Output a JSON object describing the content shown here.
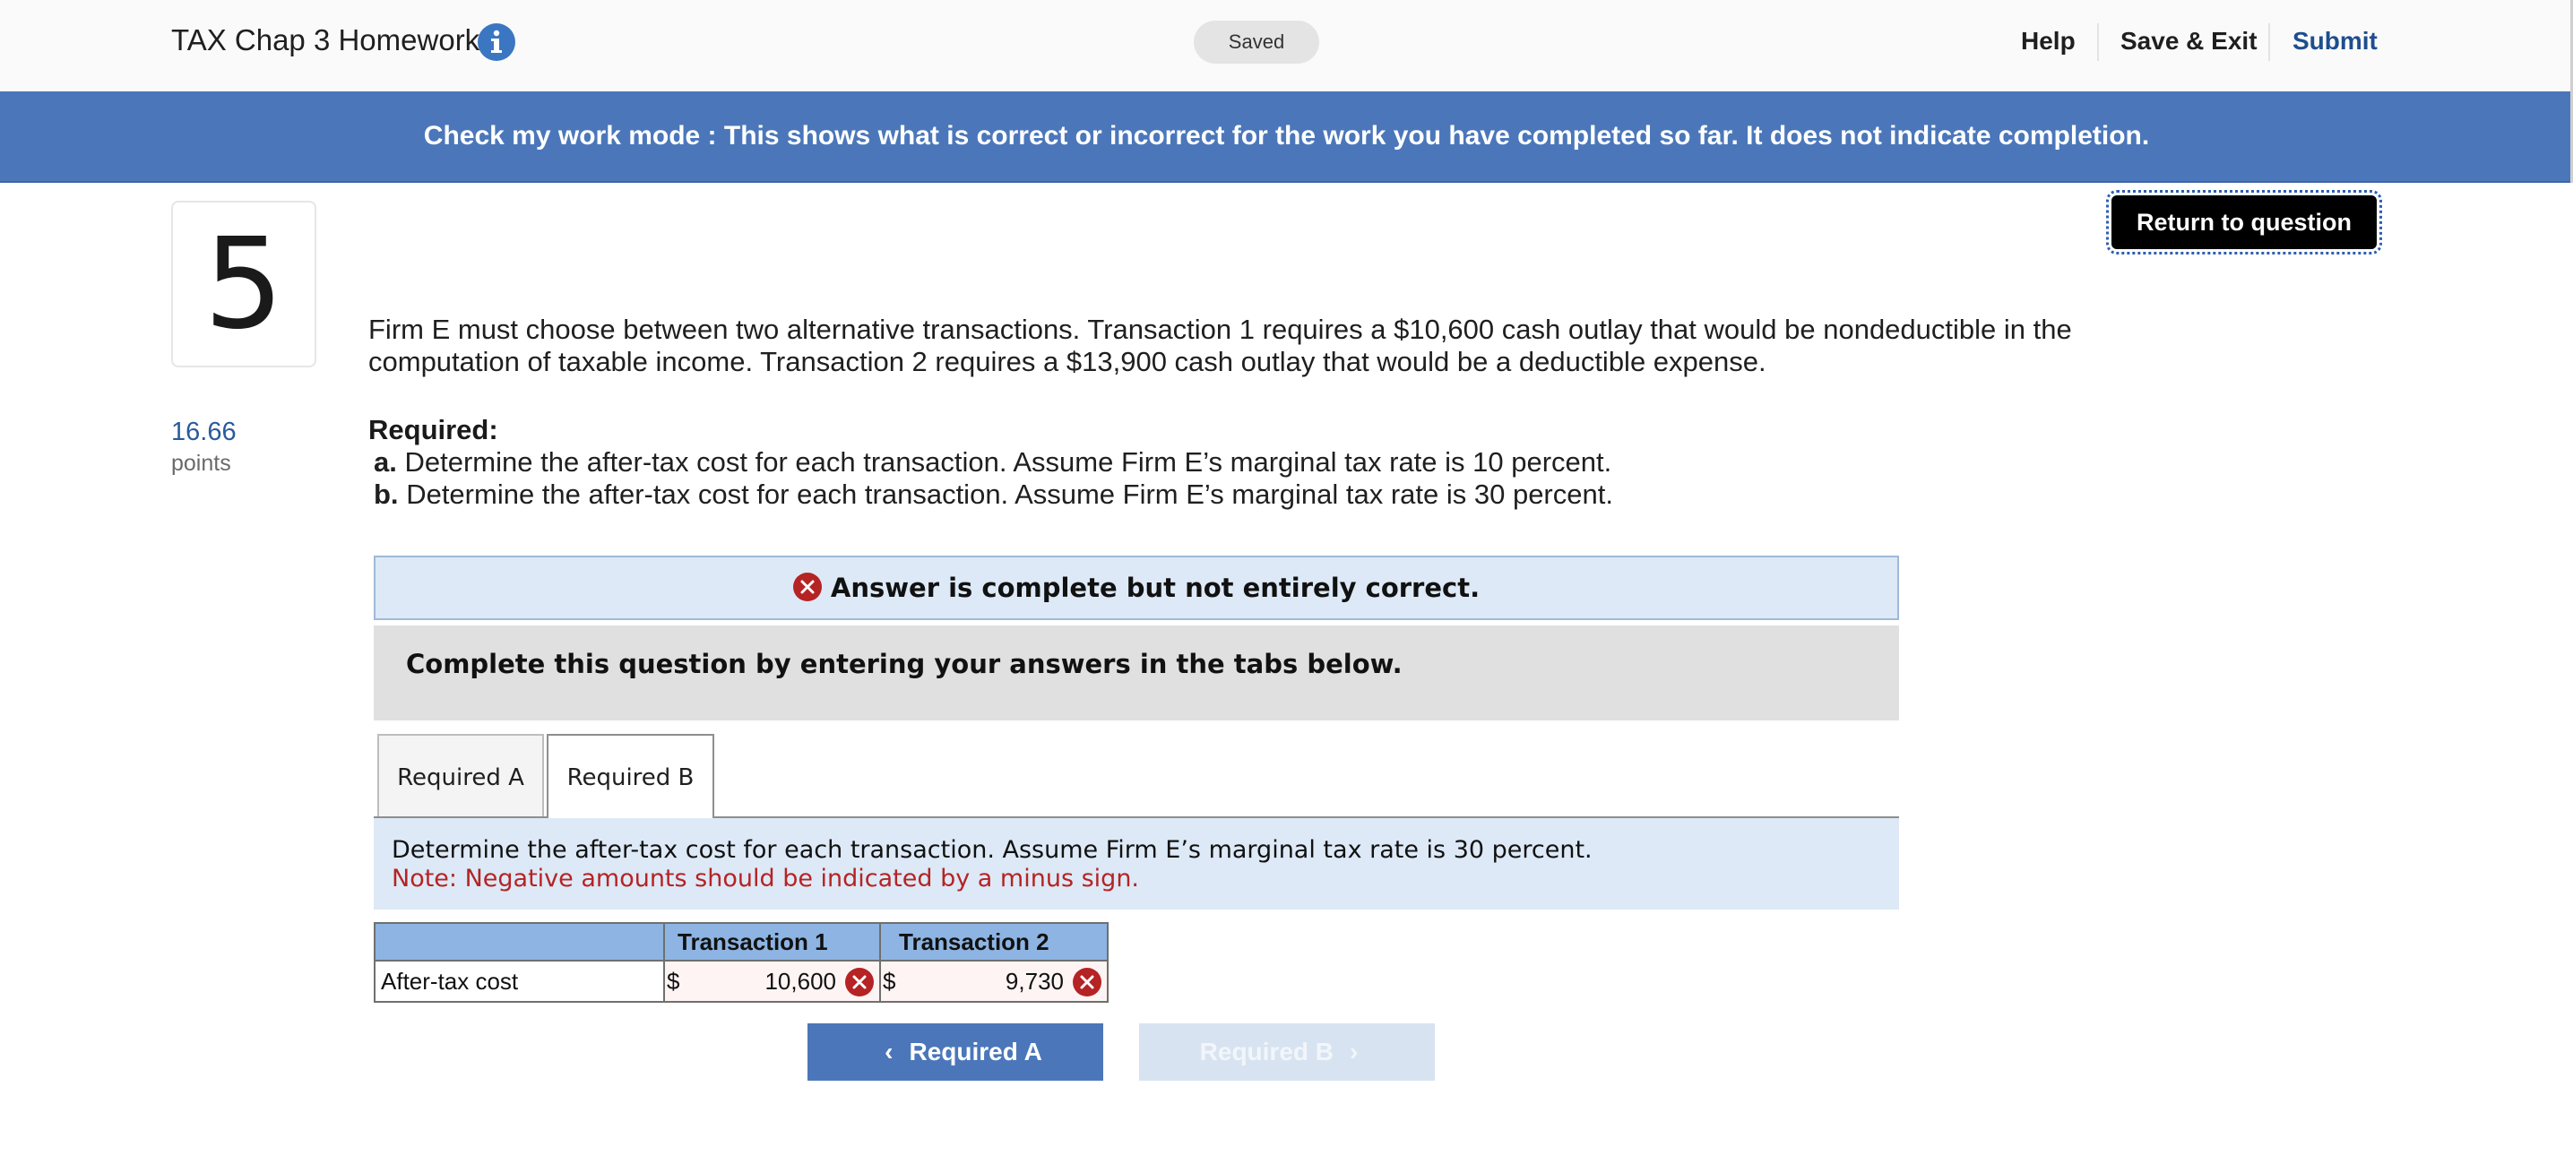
{
  "header": {
    "assignment_title": "TAX Chap 3 Homework",
    "info_icon": "info-icon",
    "saved_status": "Saved",
    "help_label": "Help",
    "save_exit_label": "Save & Exit",
    "submit_label": "Submit"
  },
  "banner": {
    "text": "Check my work mode : This shows what is correct or incorrect for the work you have completed so far. It does not indicate completion."
  },
  "return_button_label": "Return to question",
  "question": {
    "number": "5",
    "points_value": "16.66",
    "points_label": "points",
    "text": "Firm E must choose between two alternative transactions. Transaction 1 requires a $10,600 cash outlay that would be nondeductible in the computation of taxable income. Transaction 2 requires a $13,900 cash outlay that would be a deductible expense.",
    "required_title": "Required:",
    "required_items": [
      {
        "letter": "a.",
        "text": "Determine the after-tax cost for each transaction. Assume Firm E’s marginal tax rate is 10 percent."
      },
      {
        "letter": "b.",
        "text": "Determine the after-tax cost for each transaction. Assume Firm E’s marginal tax rate is 30 percent."
      }
    ]
  },
  "answer_status": "Answer is complete but not entirely correct.",
  "instructions": "Complete this question by entering your answers in the tabs below.",
  "tabs": [
    {
      "label": "Required A",
      "active": false
    },
    {
      "label": "Required B",
      "active": true
    }
  ],
  "tab_content": {
    "prompt": "Determine the after-tax cost for each transaction. Assume Firm E’s marginal tax rate is 30 percent.",
    "note": "Note: Negative amounts should be indicated by a minus sign."
  },
  "answer_table": {
    "columns": [
      "",
      "Transaction 1",
      "Transaction 2"
    ],
    "rows": [
      {
        "label": "After-tax cost",
        "currency": "$",
        "t1_value": "10,600",
        "t1_correct": false,
        "t2_value": "9,730",
        "t2_correct": false
      }
    ]
  },
  "nav": {
    "prev_label": "Required A",
    "next_label": "Required B",
    "next_disabled": true
  },
  "colors": {
    "banner": "#4b77ba",
    "submit_link": "#1d4e8f",
    "incorrect": "#b52324",
    "table_header": "#8db4e2",
    "status_box": "#dde9f6"
  }
}
